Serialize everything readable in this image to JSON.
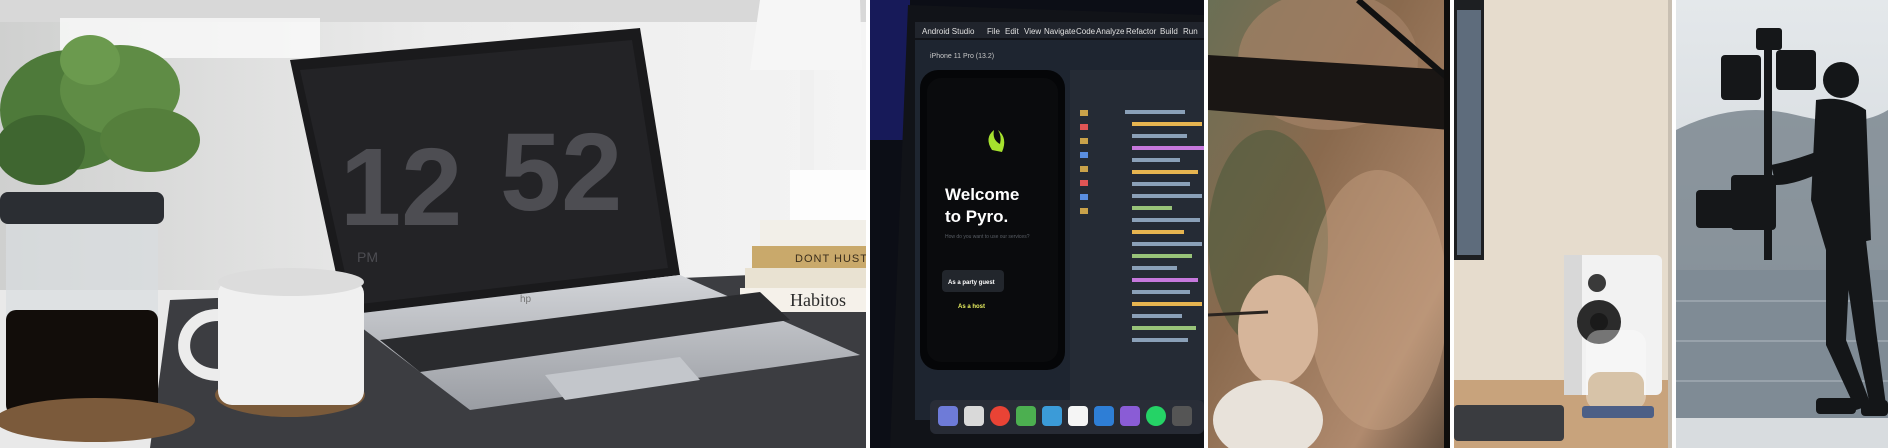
{
  "gallery": {
    "photos": [
      {
        "id_label": "laptop-desk-clock",
        "clock": {
          "hours": "12",
          "minutes": "52",
          "period": "PM"
        },
        "book_titles": [
          "Habitos",
          "DONT HUSTLE"
        ],
        "laptop_brand": "hp",
        "colors": {
          "desk_mat": "#3a3b3f",
          "laptop": "#b9bcc2",
          "wall": "#e4e4e4"
        }
      },
      {
        "id_label": "android-studio-laptop",
        "menu_items": [
          "Android Studio",
          "File",
          "Edit",
          "View",
          "Navigate",
          "Code",
          "Analyze",
          "Refactor",
          "Build",
          "Run"
        ],
        "phone_screen": {
          "title": "Welcome to Pyro.",
          "subtitle": "How do you want to use our services?",
          "primary_button": "As a party guest",
          "secondary_link": "As a host"
        },
        "device_label": "iPhone 11 Pro (13.2)",
        "colors": {
          "accent": "#a6e22e",
          "bg": "#1b2430"
        }
      },
      {
        "id_label": "painting-restoration",
        "colors": {
          "canvas": "#8a6a4e",
          "dark_bar": "#1a1614"
        }
      },
      {
        "id_label": "desk-speaker",
        "colors": {
          "wall": "#e6dccd",
          "speaker": "#f2f2f2",
          "desk": "#c8a37c"
        }
      },
      {
        "id_label": "camera-operator-lake",
        "colors": {
          "sky": "#d9dee2",
          "water": "#7f8b95",
          "silhouette": "#141618"
        }
      }
    ]
  }
}
